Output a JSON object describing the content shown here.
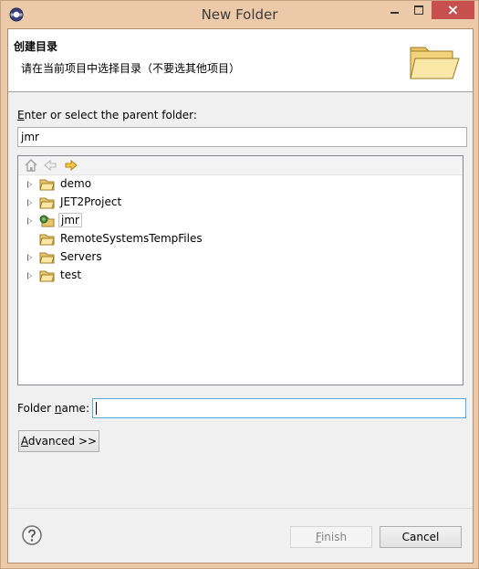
{
  "window": {
    "title": "New Folder",
    "close_glyph": "×"
  },
  "banner": {
    "title": "创建目录",
    "message": "请在当前项目中选择目录（不要选其他项目）",
    "icon": "open-folder-icon"
  },
  "parent": {
    "label_mnemonic": "E",
    "label_rest": "nter or select the parent folder:",
    "value": "jmr"
  },
  "tree_toolbar": {
    "icons": [
      "home-icon",
      "back-arrow-icon",
      "forward-arrow-icon"
    ]
  },
  "tree": {
    "items": [
      {
        "label": "demo",
        "expandable": true,
        "icon": "project-folder-icon"
      },
      {
        "label": "JET2Project",
        "expandable": true,
        "icon": "project-folder-icon"
      },
      {
        "label": "jmr",
        "expandable": true,
        "icon": "java-project-icon",
        "selected": true
      },
      {
        "label": "RemoteSystemsTempFiles",
        "expandable": false,
        "icon": "project-folder-icon"
      },
      {
        "label": "Servers",
        "expandable": true,
        "icon": "project-folder-icon"
      },
      {
        "label": "test",
        "expandable": true,
        "icon": "project-folder-icon"
      }
    ]
  },
  "folder_name": {
    "label_pre": "Folder ",
    "label_mnemonic": "n",
    "label_post": "ame:",
    "value": ""
  },
  "buttons": {
    "advanced_mnemonic": "A",
    "advanced_rest": "dvanced >>",
    "finish_mnemonic": "F",
    "finish_rest": "inish",
    "cancel": "Cancel"
  },
  "colors": {
    "titlebar": "#ecc9a8",
    "close_button": "#c7504f",
    "focus_border": "#5aa8e0"
  }
}
